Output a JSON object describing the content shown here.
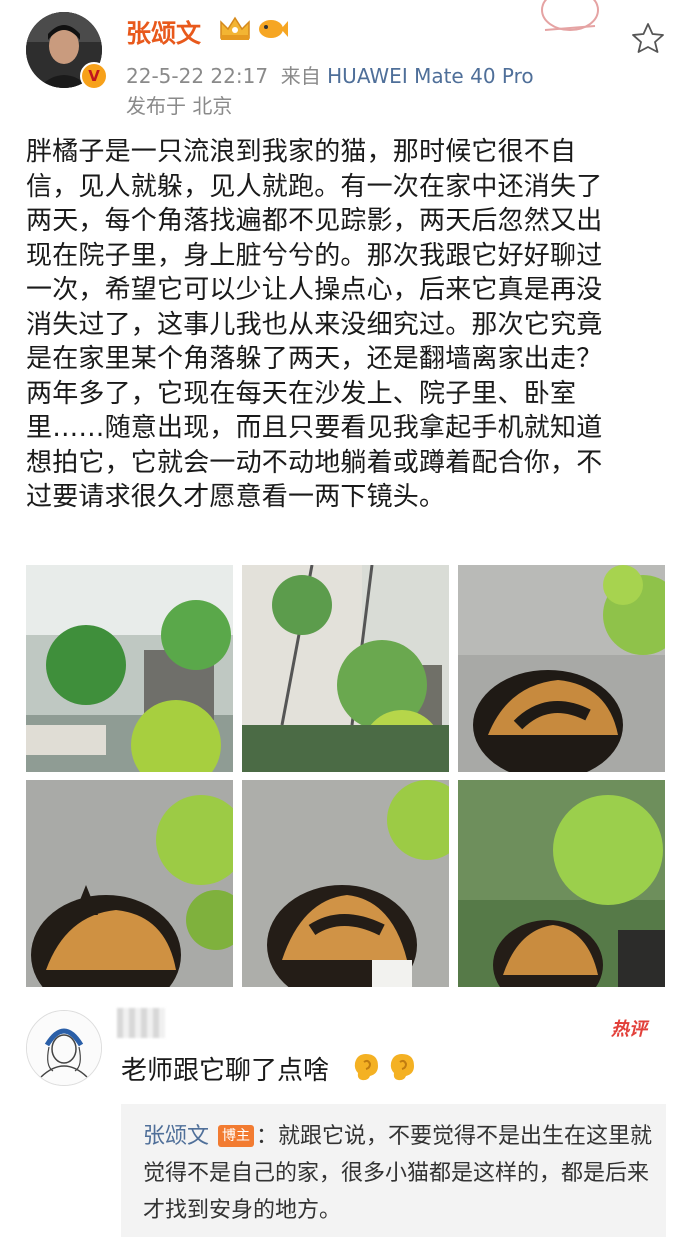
{
  "post": {
    "author": "张颂文",
    "verified_mark": "V",
    "date": "22-5-22 22:17",
    "source_prefix": "来自",
    "device": "HUAWEI Mate 40 Pro",
    "location": "发布于 北京",
    "text": "胖橘子是一只流浪到我家的猫，那时候它很不自\n信，见人就躲，见人就跑。有一次在家中还消失了\n两天，每个角落找遍都不见踪影，两天后忽然又出\n现在院子里，身上脏兮兮的。那次我跟它好好聊过\n一次，希望它可以少让人操点心，后来它真是再没\n消失过了，这事儿我也从来没细究过。那次它究竟\n是在家里某个角落躲了两天，还是翻墙离家出走？\n两年多了，它现在每天在沙发上、院子里、卧室\n里……随意出现，而且只要看见我拿起手机就知道\n想拍它，它就会一动不动地躺着或蹲着配合你，不\n过要请求很久才愿意看一两下镜头。",
    "photos": [
      "garden-plants",
      "garden-shelves",
      "cat-head-1",
      "cat-head-2",
      "cat-head-3",
      "cat-head-4"
    ]
  },
  "comment": {
    "badge": "热评",
    "text": "老师跟它聊了点啥",
    "reply": {
      "author": "张颂文",
      "badge": "博主",
      "text": "：就跟它说，不要觉得不是出生在这里就觉得不是自己的家，很多小猫都是这样的，都是后来才找到安身的地方。"
    }
  },
  "icons": [
    "crown-icon",
    "fish-icon",
    "star-icon",
    "ear-icon",
    "stamp-icon"
  ],
  "colors": {
    "author": "#e8591c",
    "link": "#4f6f99",
    "hot": "#e2403a",
    "host_badge": "#f27b31"
  }
}
